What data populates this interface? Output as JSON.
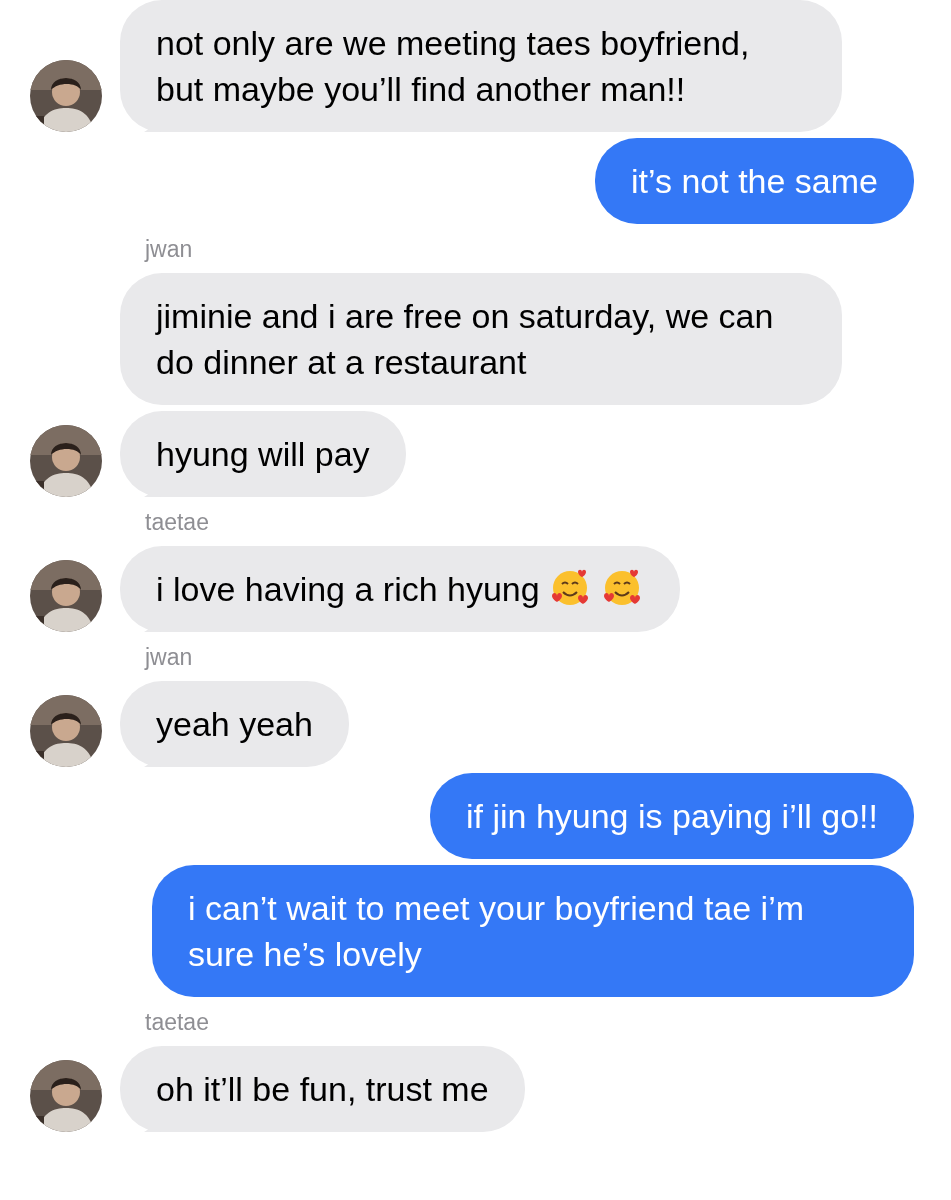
{
  "messages": [
    {
      "kind": "incoming",
      "avatar": true,
      "text": "not only are we meeting taes boyfriend, but maybe you’ll find another man!!"
    },
    {
      "kind": "outgoing",
      "text": "it’s not the same"
    },
    {
      "kind": "incoming",
      "sender": "jwan",
      "avatar": false,
      "text": "jiminie and i are free on saturday, we can do dinner at a restaurant"
    },
    {
      "kind": "incoming",
      "avatar": true,
      "text": "hyung will pay"
    },
    {
      "kind": "incoming",
      "sender": "taetae",
      "avatar": true,
      "text": "i love having a rich hyung",
      "emojis": [
        {
          "kind": "smiling-hearts"
        },
        {
          "kind": "smiling-hearts"
        }
      ]
    },
    {
      "kind": "incoming",
      "sender": "jwan",
      "avatar": true,
      "text": "yeah yeah"
    },
    {
      "kind": "outgoing",
      "text": "if jin hyung is paying i’ll go!!"
    },
    {
      "kind": "outgoing",
      "text": "i can’t wait to meet your boyfriend tae i’m sure he’s lovely"
    },
    {
      "kind": "incoming",
      "sender": "taetae",
      "avatar": true,
      "text": "oh it’ll be fun, trust me"
    }
  ]
}
